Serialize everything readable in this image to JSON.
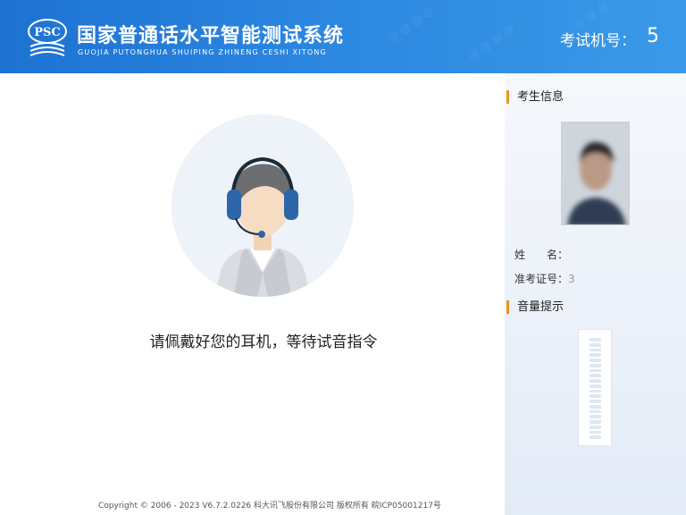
{
  "header": {
    "logo_text": "PSC",
    "title": "国家普通话水平智能测试系统",
    "subtitle": "GUOJIA PUTONGHUA SHUIPING ZHINENG CESHI XITONG",
    "machine_label": "考试机号：",
    "machine_number": "5",
    "bg_color": "#2b86e0"
  },
  "main": {
    "avatar_icon": "headset-person-icon",
    "instruction": "请佩戴好您的耳机，等待试音指令",
    "copyright": "Copyright © 2006 - 2023 V6.7.2.0226 科大讯飞股份有限公司 版权所有 皖ICP05001217号"
  },
  "sidebar": {
    "candidate_section_title": "考生信息",
    "name_label": "姓　　名：",
    "name_value": "",
    "id_label": "准考证号：",
    "id_value": "3",
    "volume_section_title": "音量提示",
    "volume_level": 0,
    "accent_color": "#f0901e"
  }
}
